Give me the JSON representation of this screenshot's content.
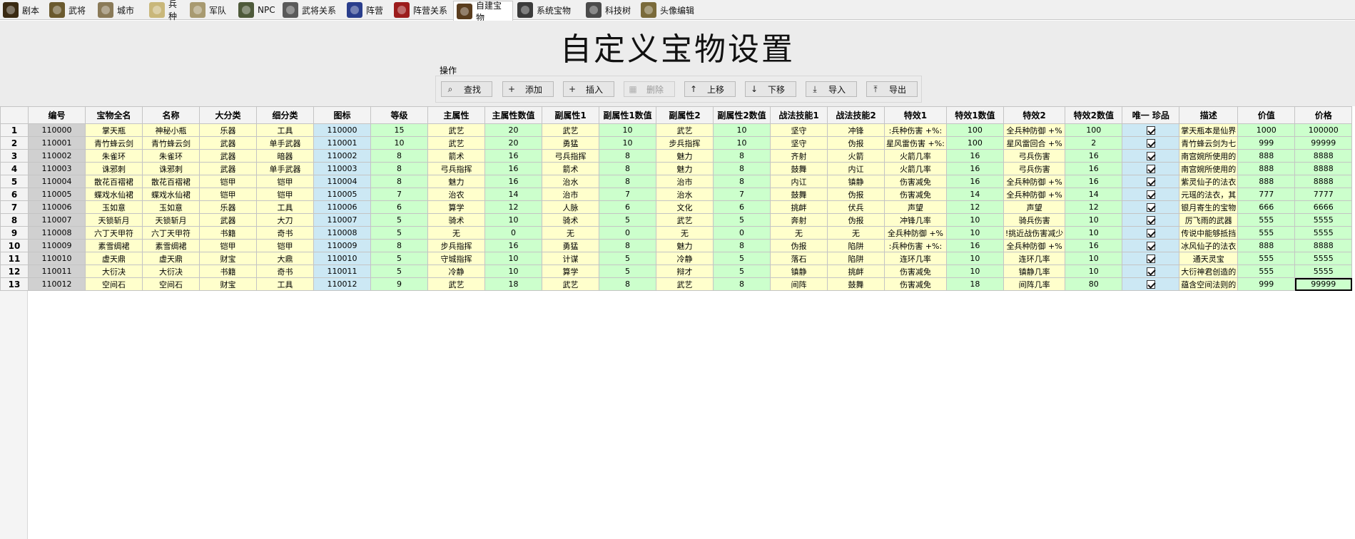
{
  "tabs": [
    {
      "label": "剧本",
      "icon": "script-scroll-icon",
      "color": "#3a2a12"
    },
    {
      "label": "武将",
      "icon": "general-helmet-icon",
      "color": "#6b5a2e"
    },
    {
      "label": "城市",
      "icon": "city-icon",
      "color": "#8a7a58"
    },
    {
      "label": "兵种",
      "icon": "soldier-icon",
      "color": "#c9b77a"
    },
    {
      "label": "军队",
      "icon": "army-icon",
      "color": "#a89a70"
    },
    {
      "label": "NPC",
      "icon": "npc-portrait-icon",
      "color": "#4e5a3a"
    },
    {
      "label": "武将关系",
      "icon": "crossed-swords-icon",
      "color": "#5a5a5a"
    },
    {
      "label": "阵营",
      "icon": "shield-icon",
      "color": "#2a3e8c"
    },
    {
      "label": "阵营关系",
      "icon": "crossed-swords-red-icon",
      "color": "#9c1c1c"
    },
    {
      "label": "自建宝物",
      "icon": "treasure-chest-icon",
      "color": "#5a3d1e"
    },
    {
      "label": "系统宝物",
      "icon": "system-treasure-icon",
      "color": "#3b3b3b"
    },
    {
      "label": "科技树",
      "icon": "tech-tree-icon",
      "color": "#4a4a4a"
    },
    {
      "label": "头像编辑",
      "icon": "portrait-edit-icon",
      "color": "#7a6a3a"
    }
  ],
  "active_tab": "自建宝物",
  "page": {
    "title": "自定义宝物设置"
  },
  "operations": {
    "label": "操作",
    "buttons": [
      {
        "label": "查找",
        "icon": "search-icon",
        "glyph": "⌕",
        "enabled": true
      },
      {
        "label": "添加",
        "icon": "plus-icon",
        "glyph": "+",
        "enabled": true
      },
      {
        "label": "插入",
        "icon": "insert-plus-icon",
        "glyph": "+",
        "enabled": true
      },
      {
        "label": "删除",
        "icon": "delete-icon",
        "glyph": "▦",
        "enabled": false
      },
      {
        "label": "上移",
        "icon": "arrow-up-icon",
        "glyph": "↑",
        "enabled": true
      },
      {
        "label": "下移",
        "icon": "arrow-down-icon",
        "glyph": "↓",
        "enabled": true
      },
      {
        "label": "导入",
        "icon": "import-icon",
        "glyph": "⤓",
        "enabled": true
      },
      {
        "label": "导出",
        "icon": "export-icon",
        "glyph": "⤒",
        "enabled": true
      }
    ]
  },
  "colors": {
    "id_cell": "#d0d0d0",
    "yellow_cell": "#ffffcc",
    "green_cell": "#ccffcc",
    "cyan_cell": "#cce8f4",
    "header_bg": "#ececec"
  },
  "table": {
    "columns": [
      "编号",
      "宝物全名",
      "名称",
      "大分类",
      "细分类",
      "图标",
      "等级",
      "主属性",
      "主属性数值",
      "副属性1",
      "副属性1数值",
      "副属性2",
      "副属性2数值",
      "战法技能1",
      "战法技能2",
      "特效1",
      "特效1数值",
      "特效2",
      "特效2数值",
      "唯一 珍品",
      "描述",
      "价值",
      "价格"
    ],
    "column_colors": [
      "id",
      "yellow",
      "yellow",
      "yellow",
      "yellow",
      "cyan",
      "green",
      "yellow",
      "green",
      "yellow",
      "green",
      "yellow",
      "green",
      "yellow",
      "yellow",
      "yellow",
      "green",
      "yellow",
      "green",
      "cyan",
      "yellow",
      "green",
      "green"
    ],
    "row_numbers": [
      "1",
      "2",
      "3",
      "4",
      "5",
      "6",
      "7",
      "8",
      "9",
      "10",
      "11",
      "12",
      "13"
    ],
    "rows": [
      [
        "110000",
        "掌天瓶",
        "神秘小瓶",
        "乐器",
        "工具",
        "110000",
        "15",
        "武艺",
        "20",
        "武艺",
        "10",
        "武艺",
        "10",
        "坚守",
        "冲锋",
        ":兵种伤害 +%:",
        "100",
        "全兵种防御 +%",
        "100",
        "checked",
        "掌天瓶本是仙界",
        "1000",
        "100000"
      ],
      [
        "110001",
        "青竹蜂云剑",
        "青竹蜂云剑",
        "武器",
        "单手武器",
        "110001",
        "10",
        "武艺",
        "20",
        "勇猛",
        "10",
        "步兵指挥",
        "10",
        "坚守",
        "伪报",
        "星风雷伤害 +%:",
        "100",
        "星风雷回合 +%",
        "2",
        "checked",
        "青竹蜂云剑为七",
        "999",
        "99999"
      ],
      [
        "110002",
        "朱雀环",
        "朱雀环",
        "武器",
        "暗器",
        "110002",
        "8",
        "箭术",
        "16",
        "弓兵指挥",
        "8",
        "魅力",
        "8",
        "齐射",
        "火箭",
        "火箭几率",
        "16",
        "弓兵伤害",
        "16",
        "checked",
        "南宫婉所使用的",
        "888",
        "8888"
      ],
      [
        "110003",
        "诛邪刺",
        "诛邪刺",
        "武器",
        "单手武器",
        "110003",
        "8",
        "弓兵指挥",
        "16",
        "箭术",
        "8",
        "魅力",
        "8",
        "鼓舞",
        "内讧",
        "火箭几率",
        "16",
        "弓兵伤害",
        "16",
        "checked",
        "南宫婉所使用的",
        "888",
        "8888"
      ],
      [
        "110004",
        "散花百褶裙",
        "散花百褶裙",
        "铠甲",
        "铠甲",
        "110004",
        "8",
        "魅力",
        "16",
        "治水",
        "8",
        "治市",
        "8",
        "内讧",
        "镇静",
        "伤害减免",
        "16",
        "全兵种防御 +%",
        "16",
        "checked",
        "紫灵仙子的法衣",
        "888",
        "8888"
      ],
      [
        "110005",
        "蝶戏水仙裙",
        "蝶戏水仙裙",
        "铠甲",
        "铠甲",
        "110005",
        "7",
        "治农",
        "14",
        "治市",
        "7",
        "治水",
        "7",
        "鼓舞",
        "伪报",
        "伤害减免",
        "14",
        "全兵种防御 +%",
        "14",
        "checked",
        "元瑶的法衣，其",
        "777",
        "7777"
      ],
      [
        "110006",
        "玉如意",
        "玉如意",
        "乐器",
        "工具",
        "110006",
        "6",
        "算学",
        "12",
        "人脉",
        "6",
        "文化",
        "6",
        "挑衅",
        "伏兵",
        "声望",
        "12",
        "声望",
        "12",
        "checked",
        "银月寄生的宝物",
        "666",
        "6666"
      ],
      [
        "110007",
        "天锁斩月",
        "天锁斩月",
        "武器",
        "大刀",
        "110007",
        "5",
        "骑术",
        "10",
        "骑术",
        "5",
        "武艺",
        "5",
        "奔射",
        "伪报",
        "冲锋几率",
        "10",
        "骑兵伤害",
        "10",
        "checked",
        "厉飞雨的武器",
        "555",
        "5555"
      ],
      [
        "110008",
        "六丁天甲符",
        "六丁天甲符",
        "书籍",
        "奇书",
        "110008",
        "5",
        "无",
        "0",
        "无",
        "0",
        "无",
        "0",
        "无",
        "无",
        "全兵种防御 +%",
        "10",
        "!挑近战伤害减少",
        "10",
        "checked",
        "传说中能够抵挡",
        "555",
        "5555"
      ],
      [
        "110009",
        "素雪绸裙",
        "素雪绸裙",
        "铠甲",
        "铠甲",
        "110009",
        "8",
        "步兵指挥",
        "16",
        "勇猛",
        "8",
        "魅力",
        "8",
        "伪报",
        "陷阱",
        ":兵种伤害 +%:",
        "16",
        "全兵种防御 +%",
        "16",
        "checked",
        "冰风仙子的法衣",
        "888",
        "8888"
      ],
      [
        "110010",
        "虚天鼎",
        "虚天鼎",
        "财宝",
        "大鼎",
        "110010",
        "5",
        "守城指挥",
        "10",
        "计谋",
        "5",
        "冷静",
        "5",
        "落石",
        "陷阱",
        "连环几率",
        "10",
        "连环几率",
        "10",
        "checked",
        "通天灵宝",
        "555",
        "5555"
      ],
      [
        "110011",
        "大衍决",
        "大衍决",
        "书籍",
        "奇书",
        "110011",
        "5",
        "冷静",
        "10",
        "算学",
        "5",
        "辩才",
        "5",
        "镇静",
        "挑衅",
        "伤害减免",
        "10",
        "镇静几率",
        "10",
        "checked",
        "大衍神君创造的",
        "555",
        "5555"
      ],
      [
        "110012",
        "空间石",
        "空间石",
        "财宝",
        "工具",
        "110012",
        "9",
        "武艺",
        "18",
        "武艺",
        "8",
        "武艺",
        "8",
        "间阵",
        "鼓舞",
        "伤害减免",
        "18",
        "间阵几率",
        "80",
        "checked",
        "蕴含空间法则的",
        "999",
        "99999"
      ]
    ],
    "selected_cell": {
      "row": 13,
      "column": "价格"
    }
  }
}
